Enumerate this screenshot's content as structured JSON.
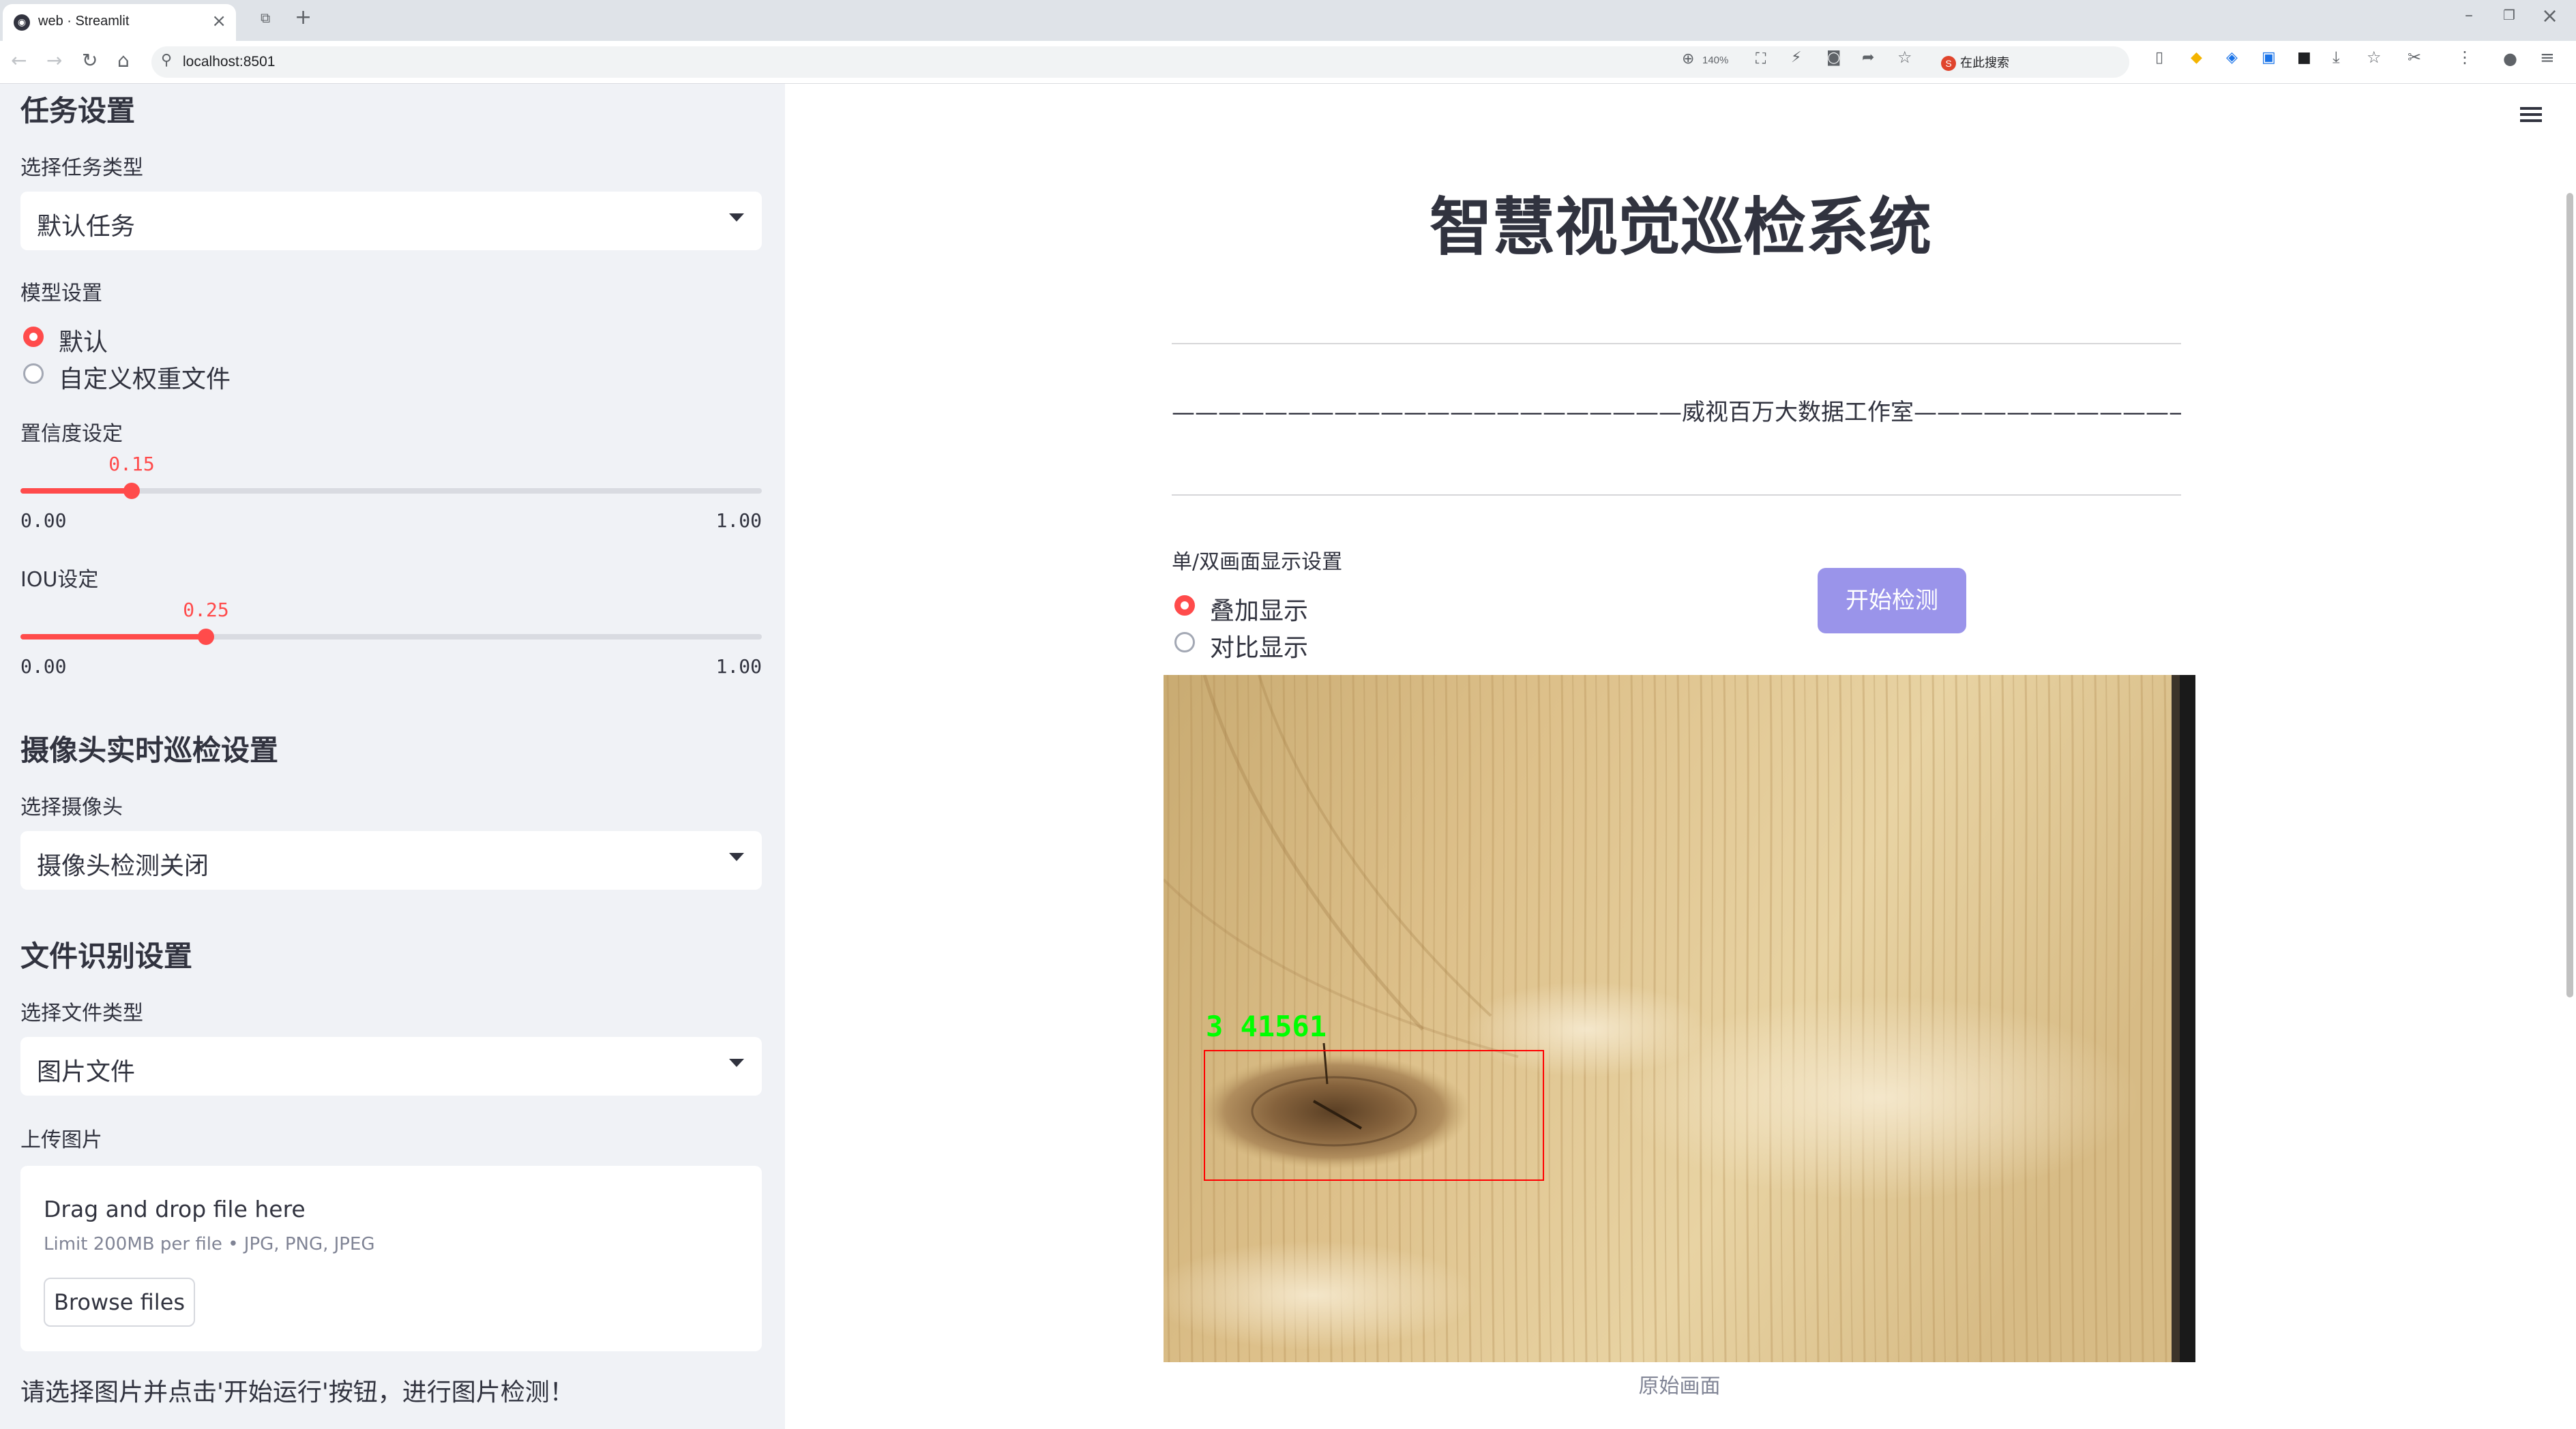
{
  "browser": {
    "tab_title": "web · Streamlit",
    "url": "localhost:8501",
    "zoom": "140%",
    "search_engine_label": "在此搜索"
  },
  "sidebar": {
    "task_section": {
      "heading": "任务设置",
      "task_type_label": "选择任务类型",
      "task_type_value": "默认任务"
    },
    "model_section": {
      "label": "模型设置",
      "options": [
        "默认",
        "自定义权重文件"
      ],
      "selected_index": 0
    },
    "confidence": {
      "label": "置信度设定",
      "value": "0.15",
      "min": "0.00",
      "max": "1.00",
      "fraction": 0.15
    },
    "iou": {
      "label": "IOU设定",
      "value": "0.25",
      "min": "0.00",
      "max": "1.00",
      "fraction": 0.25
    },
    "camera_section": {
      "heading": "摄像头实时巡检设置",
      "camera_label": "选择摄像头",
      "camera_value": "摄像头检测关闭"
    },
    "file_section": {
      "heading": "文件识别设置",
      "file_type_label": "选择文件类型",
      "file_type_value": "图片文件",
      "upload_label": "上传图片",
      "drop_text": "Drag and drop file here",
      "limit_text": "Limit 200MB per file • JPG, PNG, JPEG",
      "browse_label": "Browse files"
    },
    "hint": "请选择图片并点击'开始运行'按钮，进行图片检测！"
  },
  "main": {
    "title": "智慧视觉巡检系统",
    "subtitle": "——————————————————————威视百万大数据工作室———————————————————————",
    "display_label": "单/双画面显示设置",
    "display_options": [
      "叠加显示",
      "对比显示"
    ],
    "display_selected_index": 0,
    "start_button": "开始检测",
    "image_caption": "原始画面",
    "detection": {
      "label": "3 41561",
      "box_color": "#ff0000",
      "label_color": "#00ff00"
    }
  },
  "colors": {
    "accent": "#ff4b4b",
    "button": "#9a94ea",
    "sidebar_bg": "#f0f2f6"
  }
}
